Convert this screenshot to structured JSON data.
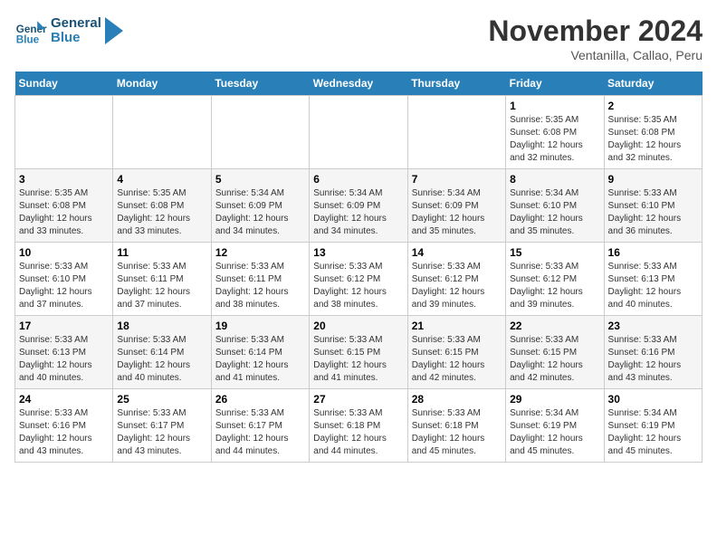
{
  "logo": {
    "text_general": "General",
    "text_blue": "Blue"
  },
  "title": "November 2024",
  "location": "Ventanilla, Callao, Peru",
  "days_of_week": [
    "Sunday",
    "Monday",
    "Tuesday",
    "Wednesday",
    "Thursday",
    "Friday",
    "Saturday"
  ],
  "weeks": [
    [
      {
        "day": "",
        "info": ""
      },
      {
        "day": "",
        "info": ""
      },
      {
        "day": "",
        "info": ""
      },
      {
        "day": "",
        "info": ""
      },
      {
        "day": "",
        "info": ""
      },
      {
        "day": "1",
        "info": "Sunrise: 5:35 AM\nSunset: 6:08 PM\nDaylight: 12 hours and 32 minutes."
      },
      {
        "day": "2",
        "info": "Sunrise: 5:35 AM\nSunset: 6:08 PM\nDaylight: 12 hours and 32 minutes."
      }
    ],
    [
      {
        "day": "3",
        "info": "Sunrise: 5:35 AM\nSunset: 6:08 PM\nDaylight: 12 hours and 33 minutes."
      },
      {
        "day": "4",
        "info": "Sunrise: 5:35 AM\nSunset: 6:08 PM\nDaylight: 12 hours and 33 minutes."
      },
      {
        "day": "5",
        "info": "Sunrise: 5:34 AM\nSunset: 6:09 PM\nDaylight: 12 hours and 34 minutes."
      },
      {
        "day": "6",
        "info": "Sunrise: 5:34 AM\nSunset: 6:09 PM\nDaylight: 12 hours and 34 minutes."
      },
      {
        "day": "7",
        "info": "Sunrise: 5:34 AM\nSunset: 6:09 PM\nDaylight: 12 hours and 35 minutes."
      },
      {
        "day": "8",
        "info": "Sunrise: 5:34 AM\nSunset: 6:10 PM\nDaylight: 12 hours and 35 minutes."
      },
      {
        "day": "9",
        "info": "Sunrise: 5:33 AM\nSunset: 6:10 PM\nDaylight: 12 hours and 36 minutes."
      }
    ],
    [
      {
        "day": "10",
        "info": "Sunrise: 5:33 AM\nSunset: 6:10 PM\nDaylight: 12 hours and 37 minutes."
      },
      {
        "day": "11",
        "info": "Sunrise: 5:33 AM\nSunset: 6:11 PM\nDaylight: 12 hours and 37 minutes."
      },
      {
        "day": "12",
        "info": "Sunrise: 5:33 AM\nSunset: 6:11 PM\nDaylight: 12 hours and 38 minutes."
      },
      {
        "day": "13",
        "info": "Sunrise: 5:33 AM\nSunset: 6:12 PM\nDaylight: 12 hours and 38 minutes."
      },
      {
        "day": "14",
        "info": "Sunrise: 5:33 AM\nSunset: 6:12 PM\nDaylight: 12 hours and 39 minutes."
      },
      {
        "day": "15",
        "info": "Sunrise: 5:33 AM\nSunset: 6:12 PM\nDaylight: 12 hours and 39 minutes."
      },
      {
        "day": "16",
        "info": "Sunrise: 5:33 AM\nSunset: 6:13 PM\nDaylight: 12 hours and 40 minutes."
      }
    ],
    [
      {
        "day": "17",
        "info": "Sunrise: 5:33 AM\nSunset: 6:13 PM\nDaylight: 12 hours and 40 minutes."
      },
      {
        "day": "18",
        "info": "Sunrise: 5:33 AM\nSunset: 6:14 PM\nDaylight: 12 hours and 40 minutes."
      },
      {
        "day": "19",
        "info": "Sunrise: 5:33 AM\nSunset: 6:14 PM\nDaylight: 12 hours and 41 minutes."
      },
      {
        "day": "20",
        "info": "Sunrise: 5:33 AM\nSunset: 6:15 PM\nDaylight: 12 hours and 41 minutes."
      },
      {
        "day": "21",
        "info": "Sunrise: 5:33 AM\nSunset: 6:15 PM\nDaylight: 12 hours and 42 minutes."
      },
      {
        "day": "22",
        "info": "Sunrise: 5:33 AM\nSunset: 6:15 PM\nDaylight: 12 hours and 42 minutes."
      },
      {
        "day": "23",
        "info": "Sunrise: 5:33 AM\nSunset: 6:16 PM\nDaylight: 12 hours and 43 minutes."
      }
    ],
    [
      {
        "day": "24",
        "info": "Sunrise: 5:33 AM\nSunset: 6:16 PM\nDaylight: 12 hours and 43 minutes."
      },
      {
        "day": "25",
        "info": "Sunrise: 5:33 AM\nSunset: 6:17 PM\nDaylight: 12 hours and 43 minutes."
      },
      {
        "day": "26",
        "info": "Sunrise: 5:33 AM\nSunset: 6:17 PM\nDaylight: 12 hours and 44 minutes."
      },
      {
        "day": "27",
        "info": "Sunrise: 5:33 AM\nSunset: 6:18 PM\nDaylight: 12 hours and 44 minutes."
      },
      {
        "day": "28",
        "info": "Sunrise: 5:33 AM\nSunset: 6:18 PM\nDaylight: 12 hours and 45 minutes."
      },
      {
        "day": "29",
        "info": "Sunrise: 5:34 AM\nSunset: 6:19 PM\nDaylight: 12 hours and 45 minutes."
      },
      {
        "day": "30",
        "info": "Sunrise: 5:34 AM\nSunset: 6:19 PM\nDaylight: 12 hours and 45 minutes."
      }
    ]
  ]
}
